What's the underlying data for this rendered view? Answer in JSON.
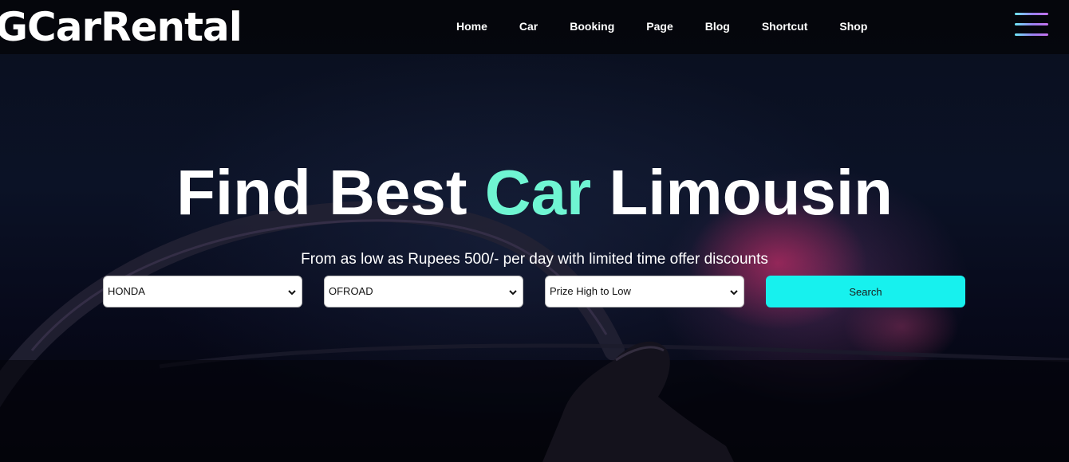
{
  "brand": {
    "logo_text": "GCarRental"
  },
  "nav": {
    "items": [
      {
        "label": "Home"
      },
      {
        "label": "Car"
      },
      {
        "label": "Booking"
      },
      {
        "label": "Page"
      },
      {
        "label": "Blog"
      },
      {
        "label": "Shortcut"
      },
      {
        "label": "Shop"
      }
    ],
    "menu_icon": "hamburger-menu-icon"
  },
  "hero": {
    "title_part1": "Find Best",
    "title_accent": "Car",
    "title_part2": "Limousin",
    "subtitle": "From as low as Rupees 500/- per day with limited time offer discounts"
  },
  "filters": {
    "brand_select": {
      "selected": "HONDA"
    },
    "type_select": {
      "selected": "OFROAD"
    },
    "sort_select": {
      "selected": "Prize High to Low"
    },
    "search_label": "Search"
  },
  "colors": {
    "accent": "#6ff5d2",
    "search_button": "#17f1ee",
    "navbar_bg": "#05060a"
  }
}
